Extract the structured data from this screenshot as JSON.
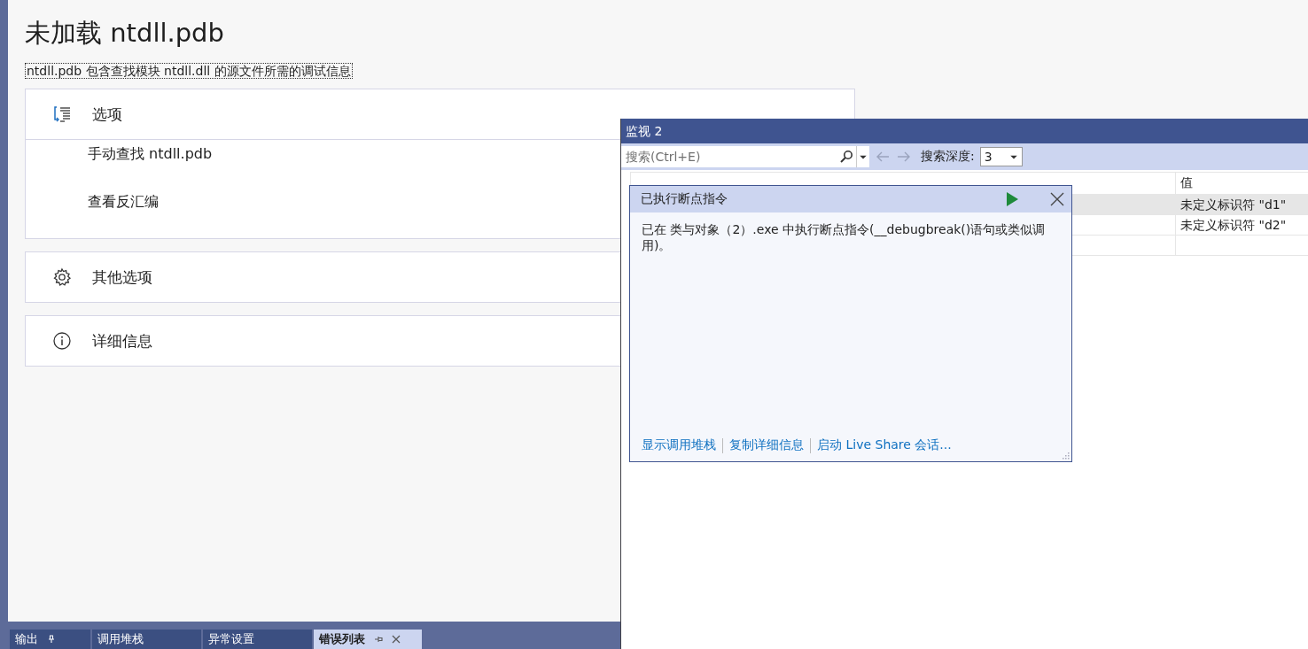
{
  "page": {
    "title": "未加载 ntdll.pdb",
    "description": "ntdll.pdb 包含查找模块 ntdll.dll 的源文件所需的调试信息",
    "sections": [
      {
        "kind": "options",
        "label": "选项",
        "expanded": true,
        "items": [
          "手动查找 ntdll.pdb",
          "查看反汇编"
        ]
      },
      {
        "kind": "settings",
        "label": "其他选项",
        "expanded": false
      },
      {
        "kind": "info",
        "label": "详细信息",
        "expanded": false
      }
    ]
  },
  "bottom_tabs": [
    {
      "label": "输出",
      "selected": false,
      "pin": true
    },
    {
      "label": "调用堆栈",
      "selected": false,
      "pin": false
    },
    {
      "label": "异常设置",
      "selected": false,
      "pin": false
    },
    {
      "label": "错误列表",
      "selected": true,
      "pin": true
    }
  ],
  "watch": {
    "title": "监视 2",
    "search": {
      "placeholder": "搜索(Ctrl+E)"
    },
    "depth_label": "搜索深度:",
    "depth": "3",
    "value_column": "值",
    "rows": [
      {
        "value": "未定义标识符 \"d1\"",
        "selected": true
      },
      {
        "value": "未定义标识符 \"d2\"",
        "selected": false
      }
    ]
  },
  "exception_popup": {
    "title": "已执行断点指令",
    "message": "已在 类与对象（2）.exe 中执行断点指令(__debugbreak()语句或类似调用)。",
    "links": [
      "显示调用堆栈",
      "复制详细信息",
      "启动 Live Share 会话..."
    ]
  }
}
